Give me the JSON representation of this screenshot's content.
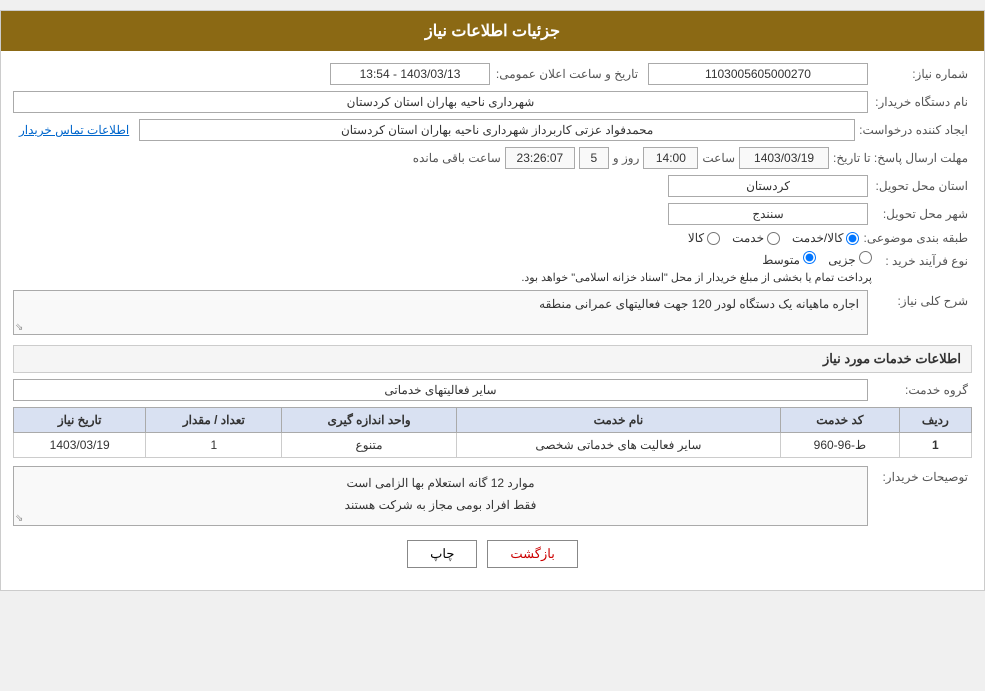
{
  "header": {
    "title": "جزئیات اطلاعات نیاز"
  },
  "fields": {
    "shomare_niaz_label": "شماره نیاز:",
    "shomare_niaz_value": "1103005605000270",
    "tarikh_label": "تاریخ و ساعت اعلان عمومی:",
    "tarikh_value": "1403/03/13 - 13:54",
    "nam_label": "نام دستگاه خریدار:",
    "nam_value": "شهرداری ناحیه بهاران استان کردستان",
    "ijad_label": "ایجاد کننده درخواست:",
    "ijad_value": "محمدفواد عزتی کاربرداز شهرداری ناحیه بهاران استان کردستان",
    "mohlat_link": "اطلاعات تماس خریدار",
    "mohlat_label": "مهلت ارسال پاسخ: تا تاریخ:",
    "mohlat_date": "1403/03/19",
    "mohlat_saat_label": "ساعت",
    "mohlat_saat": "14:00",
    "mohlat_rooz_label": "روز و",
    "mohlat_rooz": "5",
    "mohlat_baqi_label": "ساعت باقی مانده",
    "mohlat_baqi": "23:26:07",
    "ostan_label": "استان محل تحویل:",
    "ostan_value": "کردستان",
    "shahr_label": "شهر محل تحویل:",
    "shahr_value": "سنندج",
    "tabaqeh_label": "طبقه بندی موضوعی:",
    "tabaqeh_options": [
      "کالا",
      "خدمت",
      "کالا/خدمت"
    ],
    "tabaqeh_selected": "کالا/خدمت",
    "now_label": "نوع فرآیند خرید :",
    "now_options": [
      "جزیی",
      "متوسط"
    ],
    "now_selected": "متوسط",
    "now_note": "پرداخت تمام یا بخشی از مبلغ خریدار از محل \"اسناد خزانه اسلامی\" خواهد بود.",
    "sharh_label": "شرح کلی نیاز:",
    "sharh_value": "اجاره ماهیانه یک دستگاه لودر 120 جهت فعالیتهای عمرانی منطقه",
    "services_title": "اطلاعات خدمات مورد نیاز",
    "goroh_label": "گروه خدمت:",
    "goroh_value": "سایر فعالیتهای خدماتی",
    "table": {
      "headers": [
        "ردیف",
        "کد خدمت",
        "نام خدمت",
        "واحد اندازه گیری",
        "تعداد / مقدار",
        "تاریخ نیاز"
      ],
      "rows": [
        {
          "radif": "1",
          "kod": "ط-96-960",
          "nam": "سایر فعالیت های خدماتی شخصی",
          "vahed": "متنوع",
          "tedad": "1",
          "tarikh": "1403/03/19"
        }
      ]
    },
    "tawzihat_label": "توصیحات خریدار:",
    "tawzihat_line1": "موارد 12 گانه استعلام بها الزامی است",
    "tawzihat_line2": "فقط افراد بومی مجاز به شرکت هستند"
  },
  "buttons": {
    "print": "چاپ",
    "back": "بازگشت"
  }
}
